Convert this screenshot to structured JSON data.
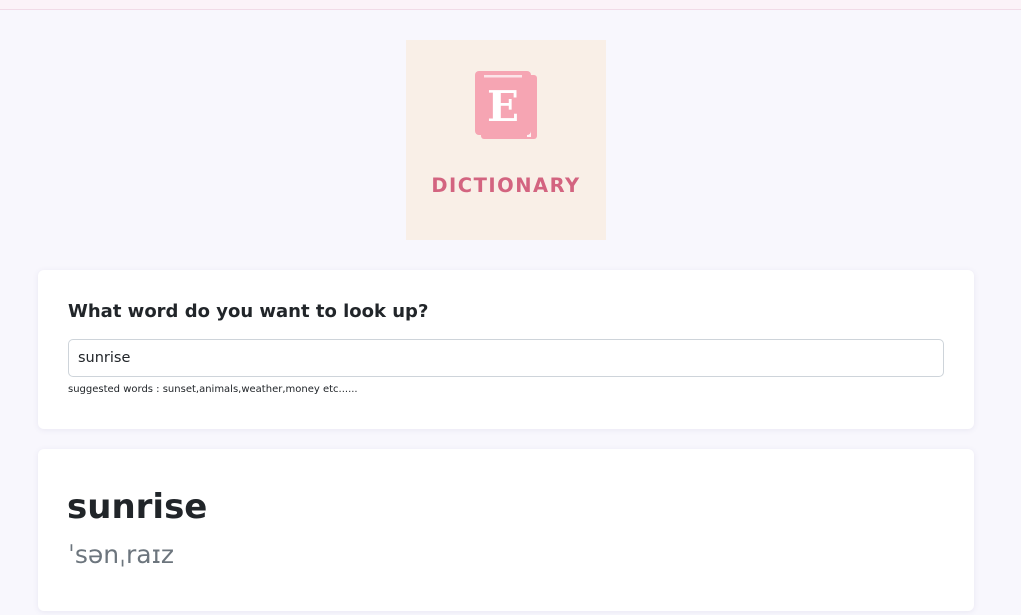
{
  "logo": {
    "icon": "book-icon",
    "letter": "E",
    "text": "DICTIONARY",
    "colors": {
      "background": "#f9efe7",
      "icon": "#f6a5b3",
      "text": "#d36480"
    }
  },
  "search": {
    "question": "What word do you want to look up?",
    "value": "sunrise",
    "hint": "suggested words : sunset,animals,weather,money etc......"
  },
  "result": {
    "word": "sunrise",
    "phonetic": "ˈsənˌraɪz"
  },
  "colors": {
    "page_background": "#f8f7fd",
    "card_background": "#ffffff",
    "top_strip": "#fbf3f8"
  }
}
